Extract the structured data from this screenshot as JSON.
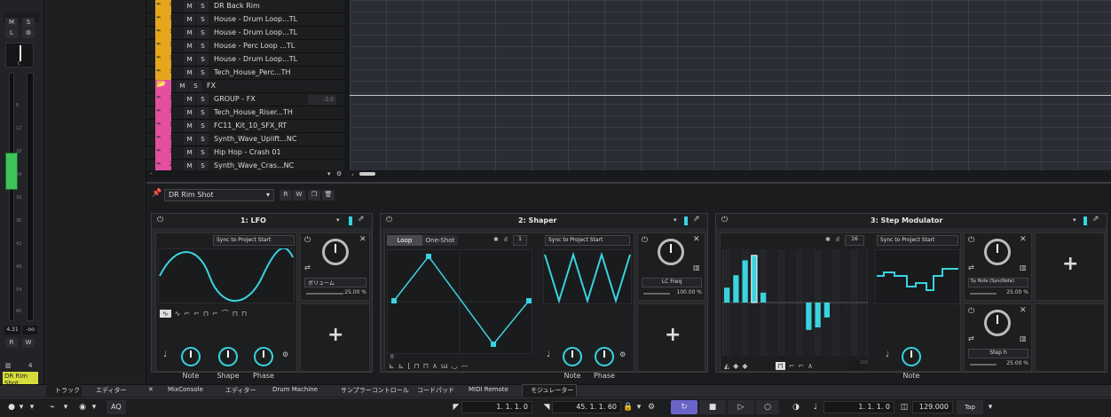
{
  "left_strip": {
    "m1": "M",
    "s1": "S",
    "l1": "L",
    "val": "4.31",
    "inf": "-oo",
    "r": "R",
    "w": "W",
    "four": "4",
    "name": "DR Rim Shot",
    "scale": [
      "6",
      "12",
      "18",
      "24",
      "30",
      "36",
      "42",
      "48",
      "54",
      "60"
    ],
    "c_label": "C"
  },
  "tracks": [
    {
      "num": "9",
      "name": "DR Back Rim",
      "color": "#e5a61e"
    },
    {
      "num": "10",
      "name": "House - Drum Loop...TL",
      "color": "#e5a61e"
    },
    {
      "num": "11",
      "name": "House - Drum Loop...TL",
      "color": "#e5a61e"
    },
    {
      "num": "12",
      "name": "House - Perc Loop  ...TL",
      "color": "#e5a61e"
    },
    {
      "num": "13",
      "name": "House - Drum Loop...TL",
      "color": "#e5a61e"
    },
    {
      "num": "14",
      "name": "Tech_House_Perc...TH",
      "color": "#e5a61e"
    },
    {
      "num": "",
      "name": "FX",
      "color": "#e24fa0",
      "folder": true
    },
    {
      "num": "15",
      "name": "GROUP - FX",
      "color": "#e24fa0",
      "vol": "-3.0"
    },
    {
      "num": "16",
      "name": "Tech_House_Riser...TH",
      "color": "#e24fa0"
    },
    {
      "num": "17",
      "name": "FC11_Kit_10_SFX_RT",
      "color": "#e24fa0"
    },
    {
      "num": "18",
      "name": "Synth_Wave_Uplift...NC",
      "color": "#e24fa0"
    },
    {
      "num": "19",
      "name": "Hip Hop - Crash 01",
      "color": "#e24fa0"
    },
    {
      "num": "20",
      "name": "Synth_Wave_Cras...NC",
      "color": "#e24fa0"
    }
  ],
  "track_buttons": {
    "m": "M",
    "s": "S"
  },
  "mod_header": {
    "track": "DR Rim Shot",
    "r": "R",
    "w": "W"
  },
  "lfo": {
    "title": "1: LFO",
    "sync": "Sync to Project Start",
    "target": "ボリューム",
    "amount": "25.00 %",
    "knobs": [
      "Note",
      "Shape",
      "Phase"
    ]
  },
  "shaper": {
    "title": "2: Shaper",
    "tab_loop": "Loop",
    "tab_oneshot": "One-Shot",
    "steps": "1",
    "sync": "Sync to Project Start",
    "target": "LC Freq",
    "amount": "100.00 %",
    "zero": "0",
    "knobs": [
      "Note",
      "Phase"
    ]
  },
  "stepmod": {
    "title": "3: Step Modulator",
    "steps": "16",
    "sync": "Sync to Project Start",
    "target1": "Sy Note (SyncNote)",
    "amount1": "25.00 %",
    "target2": "Step h",
    "amount2": "25.00 %",
    "knob": "Note",
    "percent": "100",
    "bars": [
      0.3,
      0.55,
      0.85,
      0.95,
      0.2,
      0,
      0,
      0,
      0,
      -0.55,
      -0.5,
      -0.3,
      0,
      0,
      0,
      0
    ]
  },
  "tabs": [
    "トラック",
    "エディター",
    "MixConsole",
    "エディター",
    "Drum Machine",
    "サンプラーコントロール",
    "コードパッド",
    "MIDI Remote",
    "モジュレーター"
  ],
  "transport": {
    "aq": "AQ",
    "pos1": "1. 1. 1.  0",
    "pos2": "45. 1. 1. 60",
    "pos3": "1. 1. 1.  0",
    "tempo": "129.000",
    "tap": "Tap"
  },
  "colors": {
    "accent": "#3ad3e0",
    "orange": "#e5a61e",
    "pink": "#e24fa0",
    "fader": "#3ec45a"
  }
}
